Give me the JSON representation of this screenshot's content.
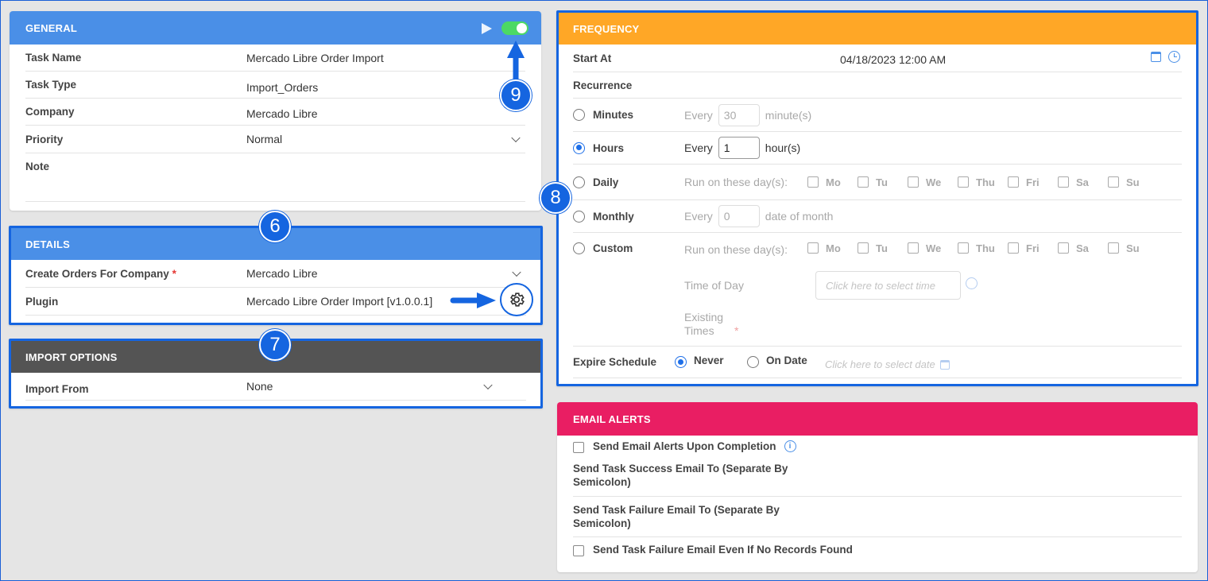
{
  "general": {
    "title": "GENERAL",
    "rows": [
      {
        "label": "Task Name",
        "value": "Mercado Libre Order Import"
      },
      {
        "label": "Task Type",
        "value": "Import_Orders"
      },
      {
        "label": "Company",
        "value": "Mercado Libre"
      },
      {
        "label": "Priority",
        "value": "Normal"
      },
      {
        "label": "Note",
        "value": ""
      }
    ],
    "enabled": true
  },
  "details": {
    "title": "DETAILS",
    "company_label": "Create Orders For Company",
    "required_mark": "*",
    "company_value": "Mercado Libre",
    "plugin_label": "Plugin",
    "plugin_value": "Mercado Libre Order Import [v1.0.0.1]"
  },
  "import_options": {
    "title": "IMPORT OPTIONS",
    "label": "Import From",
    "value": "None"
  },
  "frequency": {
    "title": "FREQUENCY",
    "start_label": "Start At",
    "start_value": "04/18/2023 12:00 AM",
    "recurrence_label": "Recurrence",
    "minutes": {
      "label": "Minutes",
      "prefix": "Every",
      "value": "30",
      "suffix": "minute(s)"
    },
    "hours": {
      "label": "Hours",
      "prefix": "Every",
      "value": "1",
      "suffix": "hour(s)"
    },
    "daily": {
      "label": "Daily",
      "prefix": "Run on these day(s):"
    },
    "monthly": {
      "label": "Monthly",
      "prefix": "Every",
      "value": "0",
      "suffix": "date of month"
    },
    "custom": {
      "label": "Custom",
      "prefix": "Run on these day(s):",
      "time_label": "Time of Day",
      "time_placeholder": "Click here to select time",
      "existing_label": "Existing Times",
      "existing_req": "*"
    },
    "days": [
      "Mo",
      "Tu",
      "We",
      "Thu",
      "Fri",
      "Sa",
      "Su"
    ],
    "expire_label": "Expire Schedule",
    "never_label": "Never",
    "on_date_label": "On Date",
    "date_placeholder": "Click here to select date"
  },
  "email": {
    "title": "EMAIL ALERTS",
    "completion_label": "Send Email Alerts Upon Completion",
    "success_label": "Send Task Success Email To (Separate By Semicolon)",
    "failure_label": "Send Task Failure Email To (Separate By Semicolon)",
    "no_records_label": "Send Task Failure Email Even If No Records Found"
  },
  "callouts": {
    "six": "6",
    "seven": "7",
    "eight": "8",
    "nine": "9"
  },
  "colors": {
    "accent": "#1565e0",
    "general": "#4a8fe7",
    "frequency": "#ffa726",
    "email": "#e91e63",
    "import": "#545454",
    "toggle": "#4cd964"
  }
}
